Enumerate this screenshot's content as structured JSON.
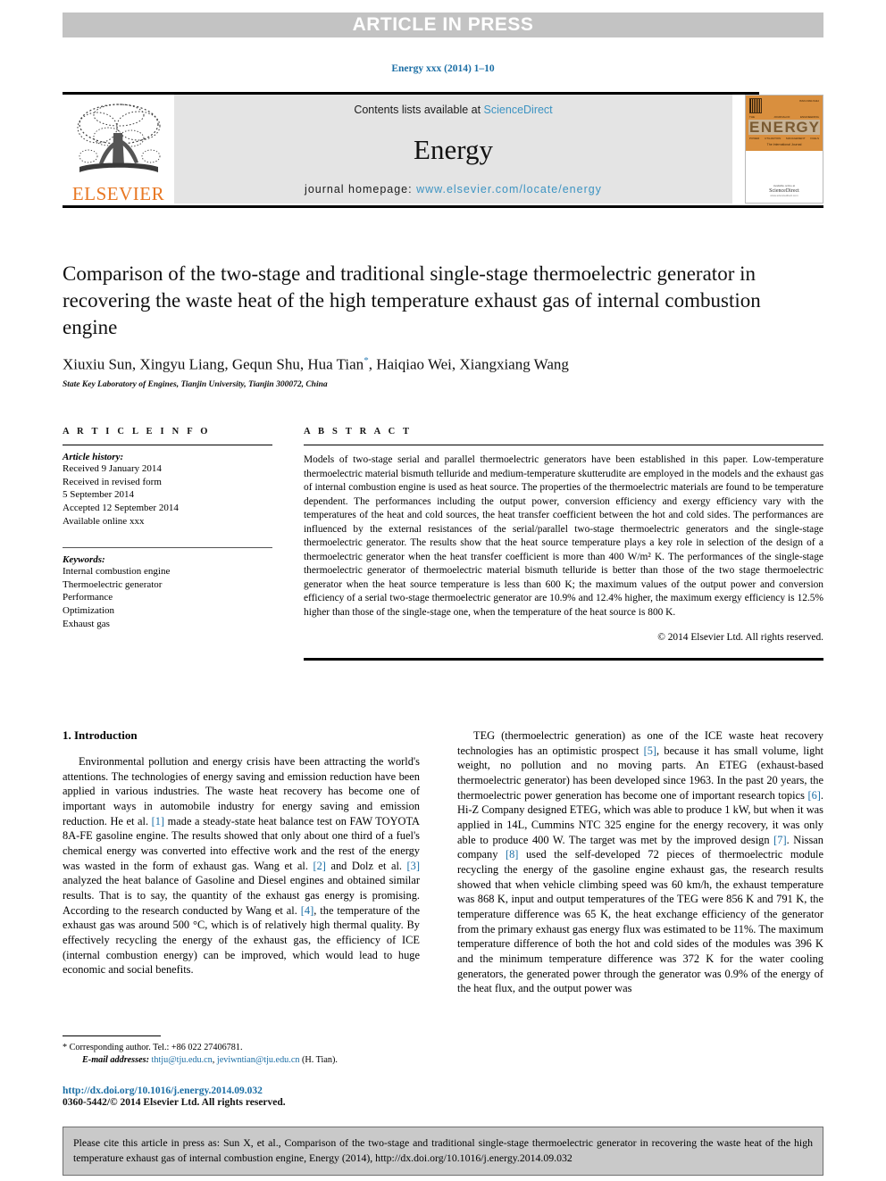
{
  "banner": {
    "text": "ARTICLE IN PRESS"
  },
  "journal_ref": "Energy xxx (2014) 1–10",
  "masthead": {
    "contents_prefix": "Contents lists available at ",
    "sciencedirect": "ScienceDirect",
    "journal_title": "Energy",
    "homepage_prefix": "journal homepage: ",
    "homepage_url": "www.elsevier.com/locate/energy",
    "publisher": "ELSEVIER",
    "publisher_color": "#E87722",
    "link_color": "#3c93c2",
    "cover": {
      "word": "ENERGY",
      "letters": [
        "E",
        "N",
        "E",
        "R",
        "G",
        "Y"
      ],
      "eyebrow": [
        "THE INTERNATIONAL",
        "JOURNAL",
        "OF ENERGY",
        "ENGINEERING"
      ],
      "footrow": [
        "POWER",
        "UTILIZATION",
        "MANAGEMENT",
        "FUELS"
      ],
      "tagline": "The International Journal",
      "issn": "ISSN 0360-5442",
      "avail": "Available online at",
      "sd": "ScienceDirect",
      "sd2": "www.sciencedirect.com",
      "top_color": "#d98f3e"
    }
  },
  "article": {
    "title": "Comparison of the two-stage and traditional single-stage thermoelectric generator in recovering the waste heat of the high temperature exhaust gas of internal combustion engine",
    "authors": "Xiuxiu Sun, Xingyu Liang, Gequn Shu, Hua Tian",
    "authors_tail": ", Haiqiao Wei, Xiangxiang Wang",
    "corresponding_marker": "*",
    "affiliation": "State Key Laboratory of Engines, Tianjin University, Tianjin 300072, China"
  },
  "info": {
    "heading": "A R T I C L E   I N F O",
    "history_label": "Article history:",
    "history": [
      "Received 9 January 2014",
      "Received in revised form",
      "5 September 2014",
      "Accepted 12 September 2014",
      "Available online xxx"
    ],
    "keywords_label": "Keywords:",
    "keywords": [
      "Internal combustion engine",
      "Thermoelectric generator",
      "Performance",
      "Optimization",
      "Exhaust gas"
    ]
  },
  "abstract": {
    "heading": "A B S T R A C T",
    "body": "Models of two-stage serial and parallel thermoelectric generators have been established in this paper. Low-temperature thermoelectric material bismuth telluride and medium-temperature skutterudite are employed in the models and the exhaust gas of internal combustion engine is used as heat source. The properties of the thermoelectric materials are found to be temperature dependent. The performances including the output power, conversion efficiency and exergy efficiency vary with the temperatures of the heat and cold sources, the heat transfer coefficient between the hot and cold sides. The performances are influenced by the external resistances of the serial/parallel two-stage thermoelectric generators and the single-stage thermoelectric generator. The results show that the heat source temperature plays a key role in selection of the design of a thermoelectric generator when the heat transfer coefficient is more than 400 W/m² K. The performances of the single-stage thermoelectric generator of thermoelectric material bismuth telluride is better than those of the two stage thermoelectric generator when the heat source temperature is less than 600 K; the maximum values of the output power and conversion efficiency of a serial two-stage thermoelectric generator are 10.9% and 12.4% higher, the maximum exergy efficiency is 12.5% higher than those of the single-stage one, when the temperature of the heat source is 800 K.",
    "copyright": "© 2014 Elsevier Ltd. All rights reserved."
  },
  "introduction": {
    "heading": "1.  Introduction",
    "left_paragraph_1": "Environmental pollution and energy crisis have been attracting the world's attentions. The technologies of energy saving and emission reduction have been applied in various industries. The waste heat recovery has become one of important ways in automobile industry for energy saving and emission reduction. He et al. ",
    "left_ref_1": "[1]",
    "left_paragraph_1b": " made a steady-state heat balance test on FAW TOYOTA 8A-FE gasoline engine. The results showed that only about one third of a fuel's chemical energy was converted into effective work and the rest of the energy was wasted in the form of exhaust gas. Wang et al. ",
    "left_ref_2": "[2]",
    "left_paragraph_1c": " and Dolz et al. ",
    "left_ref_3": "[3]",
    "left_paragraph_1d": " analyzed the heat balance of Gasoline and Diesel engines and obtained similar results. That is to say, the quantity of the exhaust gas energy is promising. According to the research conducted by Wang et al. ",
    "left_ref_4": "[4]",
    "left_paragraph_1e": ", the temperature of the exhaust gas was around 500 °C, which is of relatively high thermal quality. By effectively recycling the energy of the exhaust gas, the efficiency of ICE (internal combustion energy) can be improved, which would lead to huge economic and social benefits.",
    "right_paragraph_1": "TEG (thermoelectric generation) as one of the ICE waste heat recovery technologies has an optimistic prospect ",
    "right_ref_5": "[5]",
    "right_paragraph_1b": ", because it has small volume, light weight, no pollution and no moving parts. An ETEG (exhaust-based thermoelectric generator) has been developed since 1963. In the past 20 years, the thermoelectric power generation has become one of important research topics ",
    "right_ref_6": "[6]",
    "right_paragraph_1c": ". Hi-Z Company designed ETEG, which was able to produce 1 kW, but when it was applied in 14L, Cummins NTC 325 engine for the energy recovery, it was only able to produce 400 W. The target was met by the improved design ",
    "right_ref_7": "[7]",
    "right_paragraph_1d": ". Nissan company ",
    "right_ref_8": "[8]",
    "right_paragraph_1e": " used the self-developed 72 pieces of thermoelectric module recycling the energy of the gasoline engine exhaust gas, the research results showed that when vehicle climbing speed was 60 km/h, the exhaust temperature was 868 K, input and output temperatures of the TEG were 856 K and 791 K, the temperature difference was 65 K, the heat exchange efficiency of the generator from the primary exhaust gas energy flux was estimated to be 11%. The maximum temperature difference of both the hot and cold sides of the modules was 396 K and the minimum temperature difference was 372 K for the water cooling generators, the generated power through the generator was 0.9% of the energy of the heat flux, and the output power was"
  },
  "footnote": {
    "corresponding": "* Corresponding author. Tel.: +86 022 27406781.",
    "email_label": "E-mail addresses:",
    "email_1": "thtju@tju.edu.cn",
    "email_sep": ", ",
    "email_2": "jeviwntian@tju.edu.cn",
    "email_suffix": " (H. Tian)."
  },
  "doi": {
    "url": "http://dx.doi.org/10.1016/j.energy.2014.09.032",
    "issn_line": "0360-5442/© 2014 Elsevier Ltd. All rights reserved."
  },
  "cite_box": {
    "text": "Please cite this article in press as: Sun X, et al., Comparison of the two-stage and traditional single-stage thermoelectric generator in recovering the waste heat of the high temperature exhaust gas of internal combustion engine, Energy (2014), http://dx.doi.org/10.1016/j.energy.2014.09.032"
  }
}
